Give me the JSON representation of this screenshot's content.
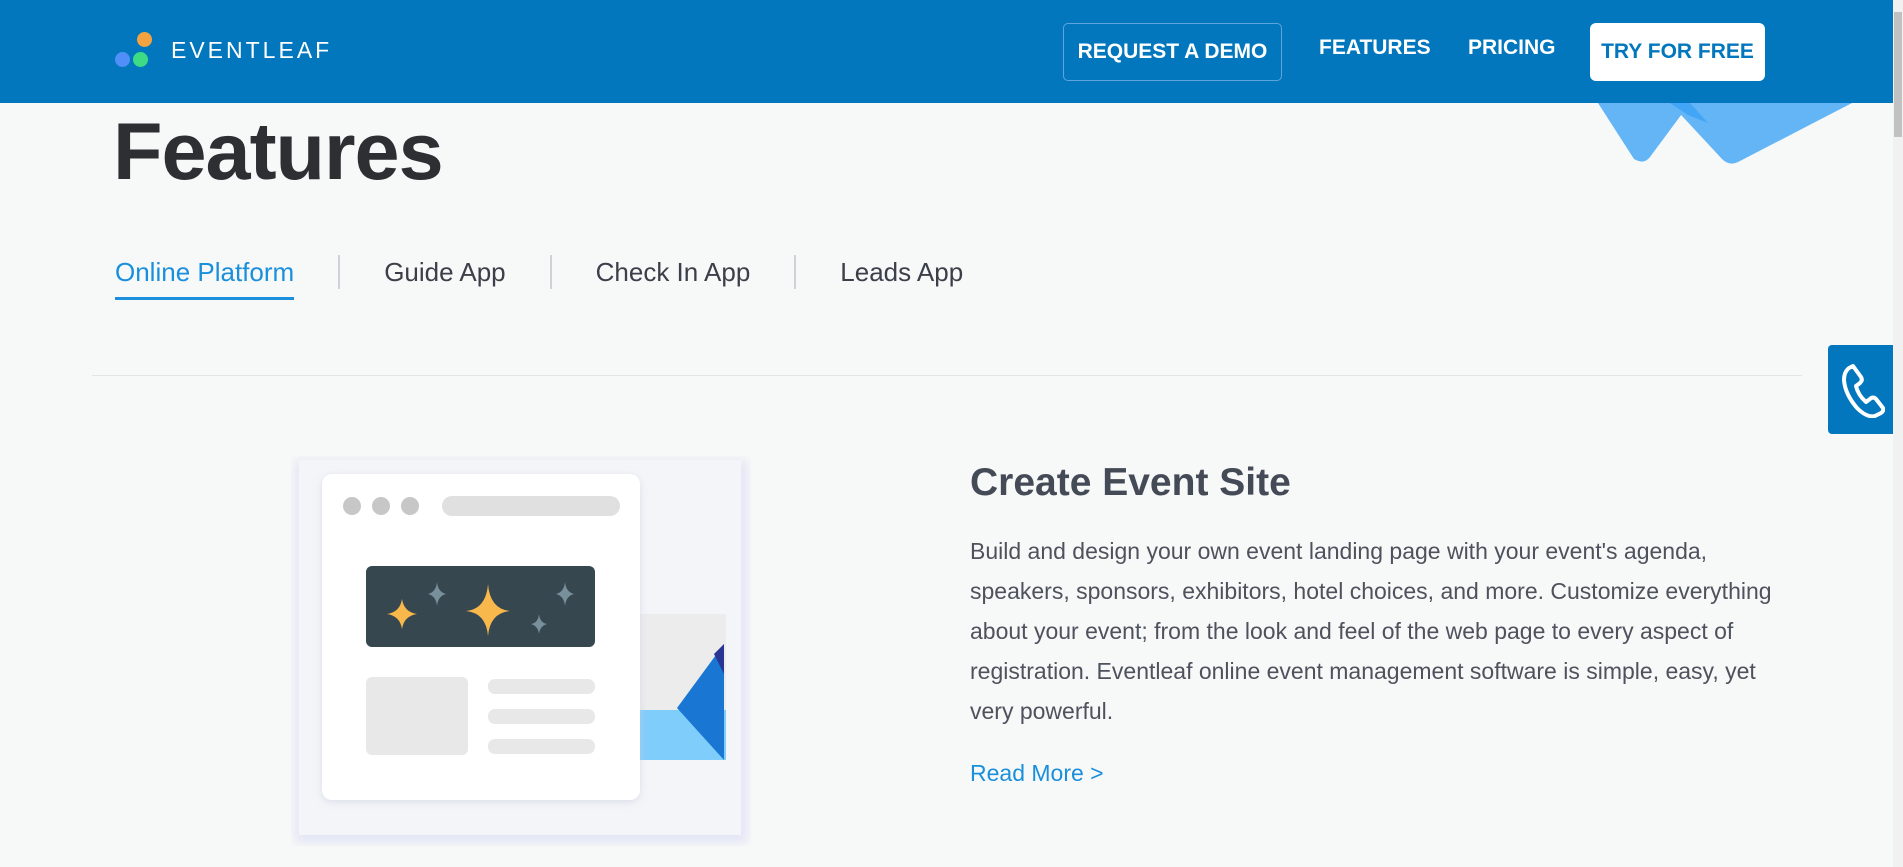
{
  "header": {
    "brand": "EVENTLEAF",
    "nav": {
      "request_demo": "REQUEST A DEMO",
      "features": "FEATURES",
      "pricing": "PRICING",
      "try_free": "TRY FOR FREE"
    }
  },
  "page_title": "Features",
  "tabs": [
    {
      "label": "Online Platform",
      "active": true
    },
    {
      "label": "Guide App",
      "active": false
    },
    {
      "label": "Check In App",
      "active": false
    },
    {
      "label": "Leads App",
      "active": false
    }
  ],
  "feature": {
    "heading": "Create Event Site",
    "description": "Build and design your own event landing page with your event's agenda, speakers, sponsors, exhibitors, hotel choices, and more. Customize everything about your event; from the look and feel of the web page to every aspect of registration. Eventleaf online event management software is simple, easy, yet very powerful.",
    "read_more": "Read More >"
  },
  "icons": {
    "phone": "phone-icon",
    "logo": "eventleaf-logo-icon"
  },
  "colors": {
    "header_bg": "#0277bd",
    "accent": "#1a8fdc",
    "background": "#f7f8f8"
  }
}
